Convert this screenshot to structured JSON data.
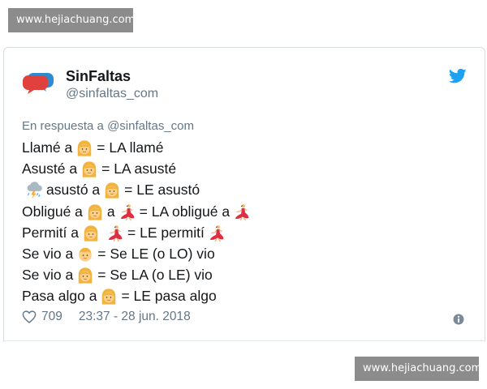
{
  "watermark": {
    "text": "www.hejiachuang.com"
  },
  "tweet": {
    "display_name": "SinFaltas",
    "handle": "@sinfaltas_com",
    "reply_to": "En respuesta a @sinfaltas_com",
    "lines": [
      {
        "parts": [
          {
            "t": "Llamé a"
          },
          {
            "e": "woman"
          },
          {
            "t": "= LA llamé"
          }
        ]
      },
      {
        "parts": [
          {
            "t": "Asusté a"
          },
          {
            "e": "woman"
          },
          {
            "t": "= LA asusté"
          }
        ]
      },
      {
        "parts": [
          {
            "e": "storm-cloud"
          },
          {
            "t": "asustó a"
          },
          {
            "e": "woman"
          },
          {
            "t": "= LE asustó"
          }
        ]
      },
      {
        "parts": [
          {
            "t": "Obligué a"
          },
          {
            "e": "woman"
          },
          {
            "t": "a"
          },
          {
            "e": "dancer"
          },
          {
            "t": "= LA obligué a"
          },
          {
            "e": "dancer"
          }
        ]
      },
      {
        "parts": [
          {
            "t": "Permití a"
          },
          {
            "e": "woman"
          },
          {
            "e": "dancer"
          },
          {
            "t": "= LE permití"
          },
          {
            "e": "dancer"
          }
        ]
      },
      {
        "parts": [
          {
            "t": "Se vio a"
          },
          {
            "e": "man"
          },
          {
            "t": "= Se LE (o LO) vio"
          }
        ]
      },
      {
        "parts": [
          {
            "t": "Se vio a"
          },
          {
            "e": "woman"
          },
          {
            "t": "= Se LA (o LE) vio"
          }
        ]
      },
      {
        "parts": [
          {
            "t": "Pasa algo a"
          },
          {
            "e": "woman"
          },
          {
            "t": "= LE pasa algo"
          }
        ]
      }
    ],
    "likes": "709",
    "timestamp": "23:37 - 28 jun. 2018"
  },
  "icons": {
    "avatar": "speech-bubbles-icon",
    "brand": "twitter-bird-icon",
    "like": "heart-icon",
    "info": "info-icon"
  },
  "colors": {
    "twitter_blue": "#1da1f2",
    "text": "#14171a",
    "muted": "#657786",
    "watermark_bg": "#8c8c8c"
  }
}
